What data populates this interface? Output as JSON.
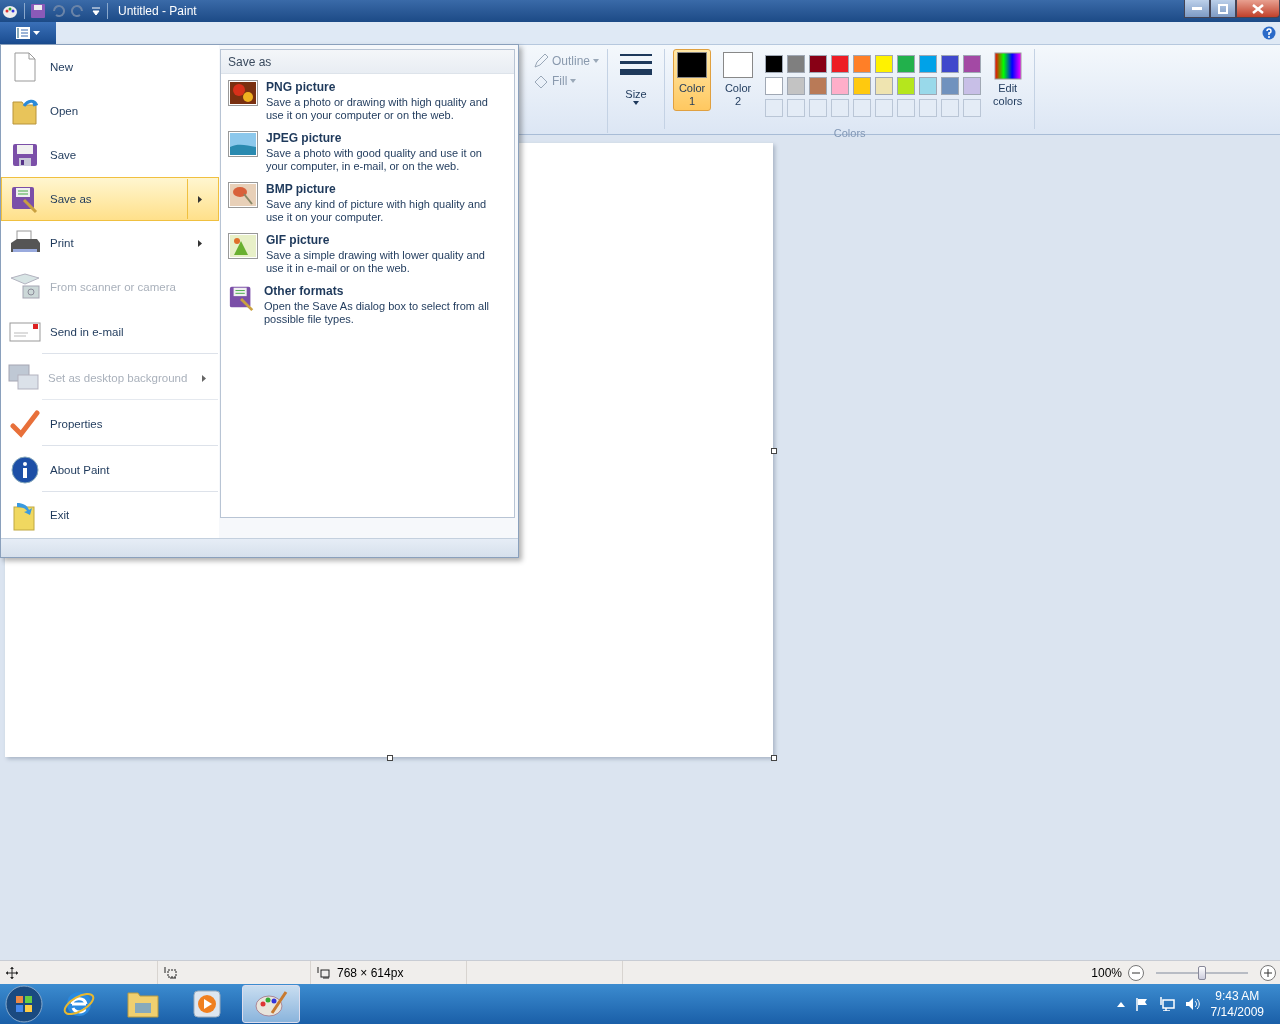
{
  "window": {
    "title": "Untitled - Paint"
  },
  "ribbon": {
    "outline": "Outline",
    "fill": "Fill",
    "size": "Size",
    "color_slots": [
      {
        "label": "Color",
        "sub": "1",
        "color": "#000000",
        "selected": true
      },
      {
        "label": "Color",
        "sub": "2",
        "color": "#ffffff",
        "selected": false
      }
    ],
    "palette": [
      {
        "color": "#000000"
      },
      {
        "color": "#7f7f7f"
      },
      {
        "color": "#880015"
      },
      {
        "color": "#ed1c24"
      },
      {
        "color": "#ff7f27"
      },
      {
        "color": "#fff200"
      },
      {
        "color": "#22b14c"
      },
      {
        "color": "#00a2e8"
      },
      {
        "color": "#3f48cc"
      },
      {
        "color": "#a349a4"
      },
      {
        "color": "#ffffff"
      },
      {
        "color": "#c3c3c3"
      },
      {
        "color": "#b97a57"
      },
      {
        "color": "#ffaec9"
      },
      {
        "color": "#ffc90e"
      },
      {
        "color": "#efe4b0"
      },
      {
        "color": "#b5e61d"
      },
      {
        "color": "#99d9ea"
      },
      {
        "color": "#7092be"
      },
      {
        "color": "#c8bfe7"
      }
    ],
    "edit_colors": [
      "Edit",
      "colors"
    ],
    "group_label": "Colors"
  },
  "app_menu": {
    "items": [
      {
        "label": "New",
        "selected": false,
        "disabled": false,
        "submenu": false,
        "divider_below": false
      },
      {
        "label": "Open",
        "selected": false,
        "disabled": false,
        "submenu": false,
        "divider_below": false
      },
      {
        "label": "Save",
        "selected": false,
        "disabled": false,
        "submenu": false,
        "divider_below": false
      },
      {
        "label": "Save as",
        "selected": true,
        "disabled": false,
        "submenu": true,
        "divider_below": false
      },
      {
        "label": "Print",
        "selected": false,
        "disabled": false,
        "submenu": true,
        "divider_below": false
      },
      {
        "label": "From scanner or camera",
        "selected": false,
        "disabled": true,
        "submenu": false,
        "divider_below": false
      },
      {
        "label": "Send in e-mail",
        "selected": false,
        "disabled": false,
        "submenu": false,
        "divider_below": true
      },
      {
        "label": "Set as desktop background",
        "selected": false,
        "disabled": true,
        "submenu": true,
        "divider_below": true
      },
      {
        "label": "Properties",
        "selected": false,
        "disabled": false,
        "submenu": false,
        "divider_below": true
      },
      {
        "label": "About Paint",
        "selected": false,
        "disabled": false,
        "submenu": false,
        "divider_below": true
      },
      {
        "label": "Exit",
        "selected": false,
        "disabled": false,
        "submenu": false,
        "divider_below": false
      }
    ],
    "submenu": {
      "title": "Save as",
      "items": [
        {
          "title": "PNG picture",
          "description": "Save a photo or drawing with high quality and use it on your computer or on the web."
        },
        {
          "title": "JPEG picture",
          "description": "Save a photo with good quality and use it on your computer, in e-mail, or on the web."
        },
        {
          "title": "BMP picture",
          "description": "Save any kind of picture with high quality and use it on your computer."
        },
        {
          "title": "GIF picture",
          "description": "Save a simple drawing with lower quality and use it in e-mail or on the web."
        },
        {
          "title": "Other formats",
          "description": "Open the Save As dialog box to select from all possible file types."
        }
      ]
    }
  },
  "status_bar": {
    "image_size": "768 × 614px",
    "zoom": "100%",
    "zoom_level": {
      "level": 0.5
    }
  },
  "taskbar": {
    "apps": [
      {
        "selected": false
      },
      {
        "selected": false
      },
      {
        "selected": false
      },
      {
        "selected": true
      }
    ],
    "time": "9:43 AM",
    "date": "7/14/2009"
  }
}
